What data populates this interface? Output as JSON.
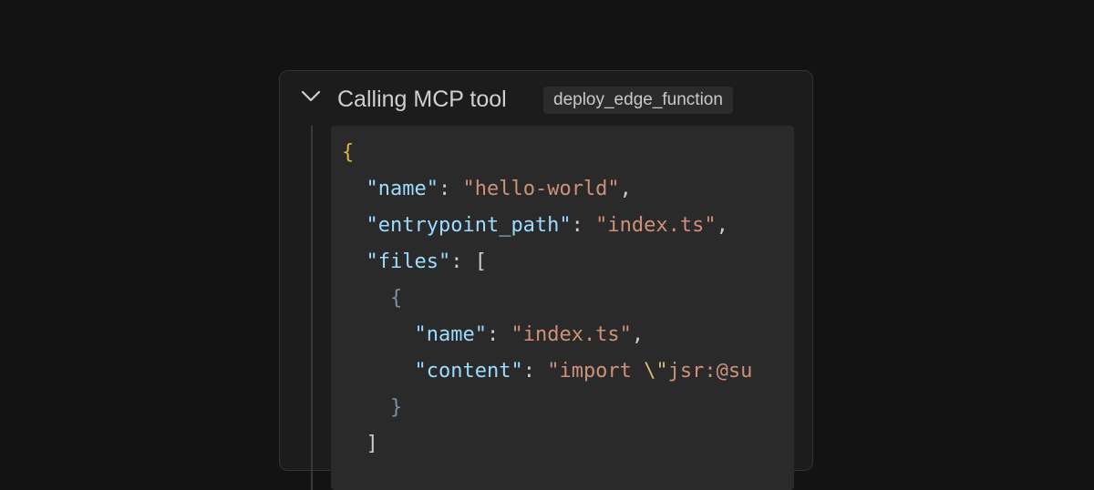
{
  "panel": {
    "header_title": "Calling MCP tool",
    "tool_name": "deploy_edge_function",
    "chevron_icon": "chevron-down-icon"
  },
  "code": {
    "open_brace": "{",
    "name_key": "\"name\"",
    "name_value": "\"hello-world\"",
    "entrypoint_key": "\"entrypoint_path\"",
    "entrypoint_value": "\"index.ts\"",
    "files_key": "\"files\"",
    "files_open": "[",
    "file_open": "{",
    "file_name_key": "\"name\"",
    "file_name_value": "\"index.ts\"",
    "file_content_key": "\"content\"",
    "file_content_value_start": "\"import ",
    "file_content_escape": "\\\"",
    "file_content_value_rest": "jsr:@su",
    "file_close": "}",
    "files_close": "]"
  },
  "colors": {
    "background": "#131313",
    "panel": "#1c1c1c",
    "code_background": "#2a2a2a",
    "key": "#9cdcfe",
    "string": "#ce9178",
    "outer_brace": "#e3b341",
    "inner_brace": "#7f8fa6"
  }
}
